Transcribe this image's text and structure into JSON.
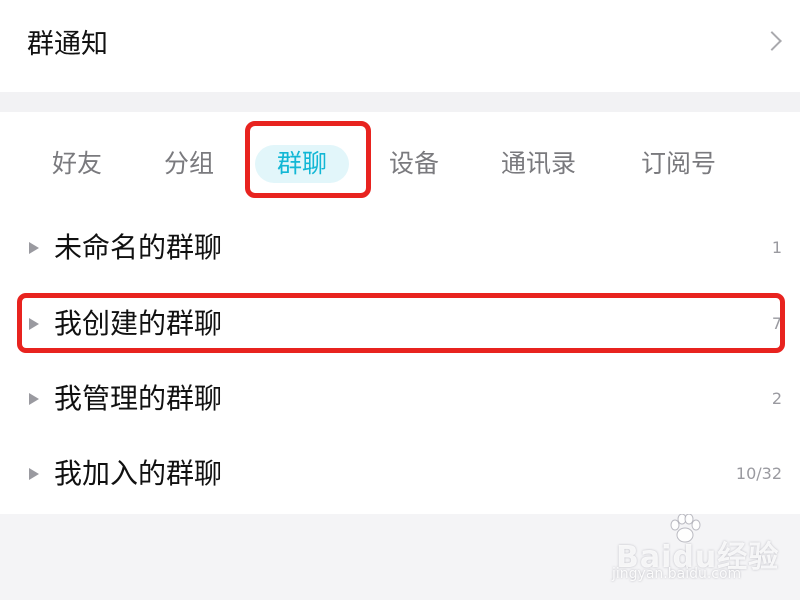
{
  "notice": {
    "title": "群通知"
  },
  "tabs": [
    {
      "label": "好友",
      "active": false
    },
    {
      "label": "分组",
      "active": false
    },
    {
      "label": "群聊",
      "active": true
    },
    {
      "label": "设备",
      "active": false
    },
    {
      "label": "通讯录",
      "active": false
    },
    {
      "label": "订阅号",
      "active": false
    }
  ],
  "groups": [
    {
      "label": "未命名的群聊",
      "count": "1"
    },
    {
      "label": "我创建的群聊",
      "count": "7"
    },
    {
      "label": "我管理的群聊",
      "count": "2"
    },
    {
      "label": "我加入的群聊",
      "count": "10/32"
    }
  ],
  "watermark": {
    "brand": "Baidu经验",
    "url": "jingyan.baidu.com"
  },
  "colors": {
    "accent": "#12b7d5",
    "active_tab_bg": "#e2f6fa",
    "highlight": "#e8231f",
    "text": "#111111",
    "muted": "#9a9aa0"
  },
  "icons": [
    "chevron-right-icon",
    "caret-right-icon",
    "baidu-paw-icon"
  ]
}
